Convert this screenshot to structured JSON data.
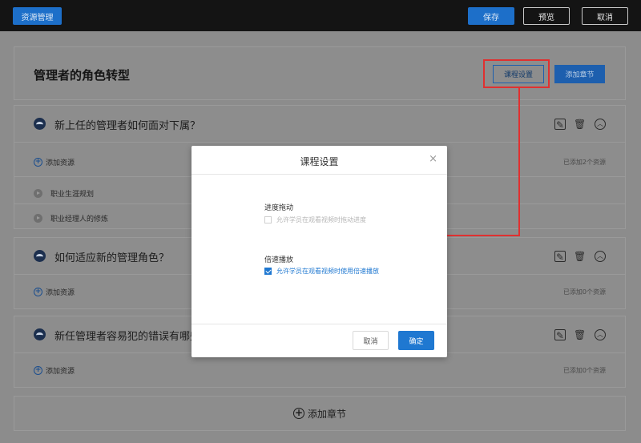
{
  "topbar": {
    "resource_label": "资源管理",
    "save_label": "保存",
    "preview_label": "预览",
    "cancel_label": "取消"
  },
  "course": {
    "title": "管理者的角色转型",
    "settings_label": "课程设置",
    "add_chapter_label": "添加章节"
  },
  "chapters": [
    {
      "title": "新上任的管理者如何面对下属？",
      "add_resource_label": "添加资源",
      "resource_count": "已添加2个资源",
      "items": [
        "职业生涯规划",
        "职业经理人的修炼"
      ]
    },
    {
      "title": "如何适应新的管理角色？",
      "add_resource_label": "添加资源",
      "resource_count": "已添加0个资源"
    },
    {
      "title": "新任管理者容易犯的错误有哪些？",
      "add_resource_label": "添加资源",
      "resource_count": "已添加0个资源"
    }
  ],
  "bottom": {
    "add_chapter_label": "添加章节"
  },
  "modal": {
    "title": "课程设置",
    "close": "×",
    "progress_section": "进度拖动",
    "progress_option": "允许学员在观看视频时拖动进度",
    "progress_checked": false,
    "speed_section": "倍速播放",
    "speed_option": "允许学员在观看视频时使用倍速播放",
    "speed_checked": true,
    "cancel_label": "取消",
    "ok_label": "确定"
  },
  "colors": {
    "accent": "#1f78d1",
    "highlight": "#e03030",
    "topbar": "#141414"
  }
}
